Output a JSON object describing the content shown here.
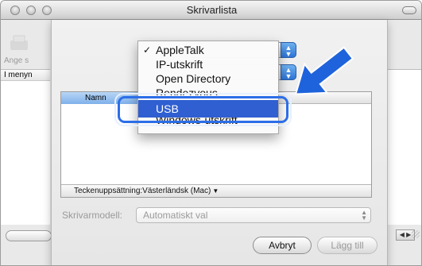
{
  "window": {
    "title": "Skrivarlista"
  },
  "background": {
    "toolbar_label": "Ange s",
    "list_header": "I menyn"
  },
  "menu": {
    "items": [
      {
        "label": "AppleTalk",
        "checked": true
      },
      {
        "label": "IP-utskrift",
        "checked": false
      },
      {
        "label": "Open Directory",
        "checked": false
      },
      {
        "label": "Rendezvous",
        "checked": false
      },
      {
        "label": "USB",
        "checked": false,
        "highlighted": true
      },
      {
        "label": "Windows-utskrift",
        "checked": false
      }
    ],
    "check_glyph": "✓"
  },
  "table": {
    "column_name": "Namn",
    "footer_label": "Teckenuppsättning:Västerländsk (Mac)"
  },
  "model": {
    "label": "Skrivarmodell:",
    "value": "Automatiskt val"
  },
  "buttons": {
    "cancel": "Avbryt",
    "add": "Lägg till"
  },
  "colors": {
    "highlight": "#2f5fd1",
    "callout": "#2c6ee8",
    "arrow": "#1f63dc"
  },
  "icons": [
    "close-icon",
    "minimize-icon",
    "zoom-icon",
    "toolbar-pill",
    "popup-arrows-icon",
    "pointer-arrow-icon"
  ]
}
